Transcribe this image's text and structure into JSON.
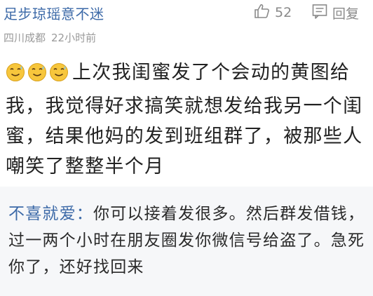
{
  "comment": {
    "username": "足步琼瑶意不迷",
    "like_count": "52",
    "reply_label": "回复",
    "location": "四川成都",
    "time": "22小时前",
    "emoji_names": [
      "sweat-smile-emoji",
      "sweat-smile-emoji",
      "sweat-smile-emoji"
    ],
    "text": "上次我闺蜜发了个会动的黄图给我，我觉得好求搞笑就想发给我另一个闺蜜，结果他妈的发到班组群了，被那些人嘲笑了整整半个月"
  },
  "quoted_reply": {
    "name": "不喜就爱：",
    "text": "你可以接着发很多。然后群发借钱，过一两个小时在朋友圈发你微信号给盗了。急死你了，还好找回来"
  },
  "colors": {
    "username": "#3d6aa8",
    "meta": "#9a9a9a",
    "body": "#222222",
    "quote_bg": "#f6f7f9"
  }
}
